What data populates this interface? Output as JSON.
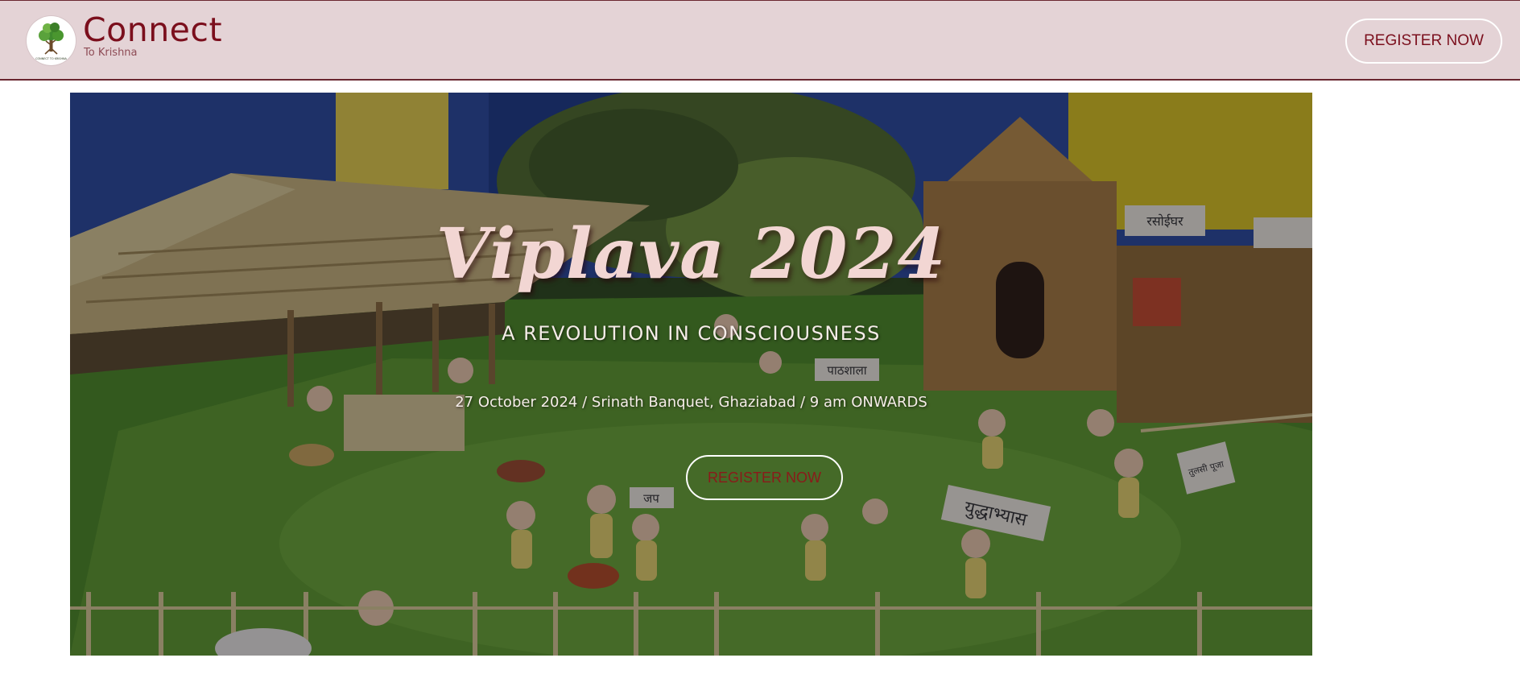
{
  "header": {
    "brand_name": "Connect",
    "brand_sub": "To Krishna",
    "logo_caption": "CONNECT TO KRISHNA",
    "register_label": "REGISTER NOW"
  },
  "hero": {
    "title": "Viplava 2024",
    "subtitle": "A REVOLUTION IN CONSCIOUSNESS",
    "details": "27 October 2024 / Srinath Banquet, Ghaziabad / 9 am ONWARDS",
    "register_label": "REGISTER NOW",
    "background_image": "diorama of a village with grass field, bamboo huts, temple and small figurines",
    "sign_labels": [
      "पाठशाला",
      "जप",
      "युद्धाभ्यास",
      "तुलसी पूजा",
      "रसोईघर"
    ]
  },
  "colors": {
    "header_bg": "#e4d3d6",
    "brand": "#7b0f1d",
    "title": "#f2d6d3"
  }
}
